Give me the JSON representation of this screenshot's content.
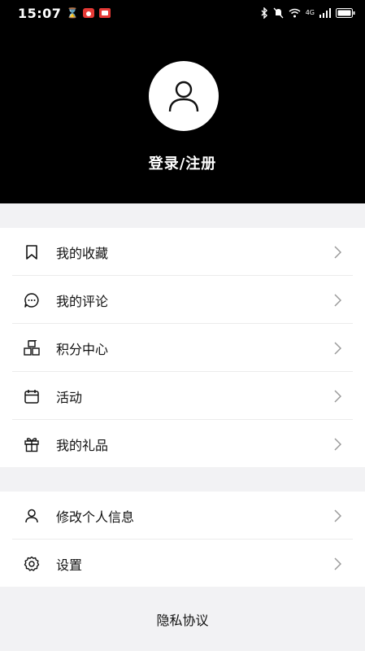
{
  "status_bar": {
    "time": "15:07",
    "network_label": "4G"
  },
  "profile": {
    "login_label": "登录/注册"
  },
  "menu_group_1": [
    {
      "label": "我的收藏",
      "icon": "bookmark-icon"
    },
    {
      "label": "我的评论",
      "icon": "comment-icon"
    },
    {
      "label": "积分中心",
      "icon": "cubes-icon"
    },
    {
      "label": "活动",
      "icon": "calendar-icon"
    },
    {
      "label": "我的礼品",
      "icon": "gift-icon"
    }
  ],
  "menu_group_2": [
    {
      "label": "修改个人信息",
      "icon": "user-icon"
    },
    {
      "label": "设置",
      "icon": "gear-icon"
    }
  ],
  "footer": {
    "privacy_label": "隐私协议"
  },
  "colors": {
    "header_bg": "#000000",
    "page_bg": "#f2f2f4",
    "card_bg": "#ffffff",
    "chevron": "#9a9a9a"
  }
}
